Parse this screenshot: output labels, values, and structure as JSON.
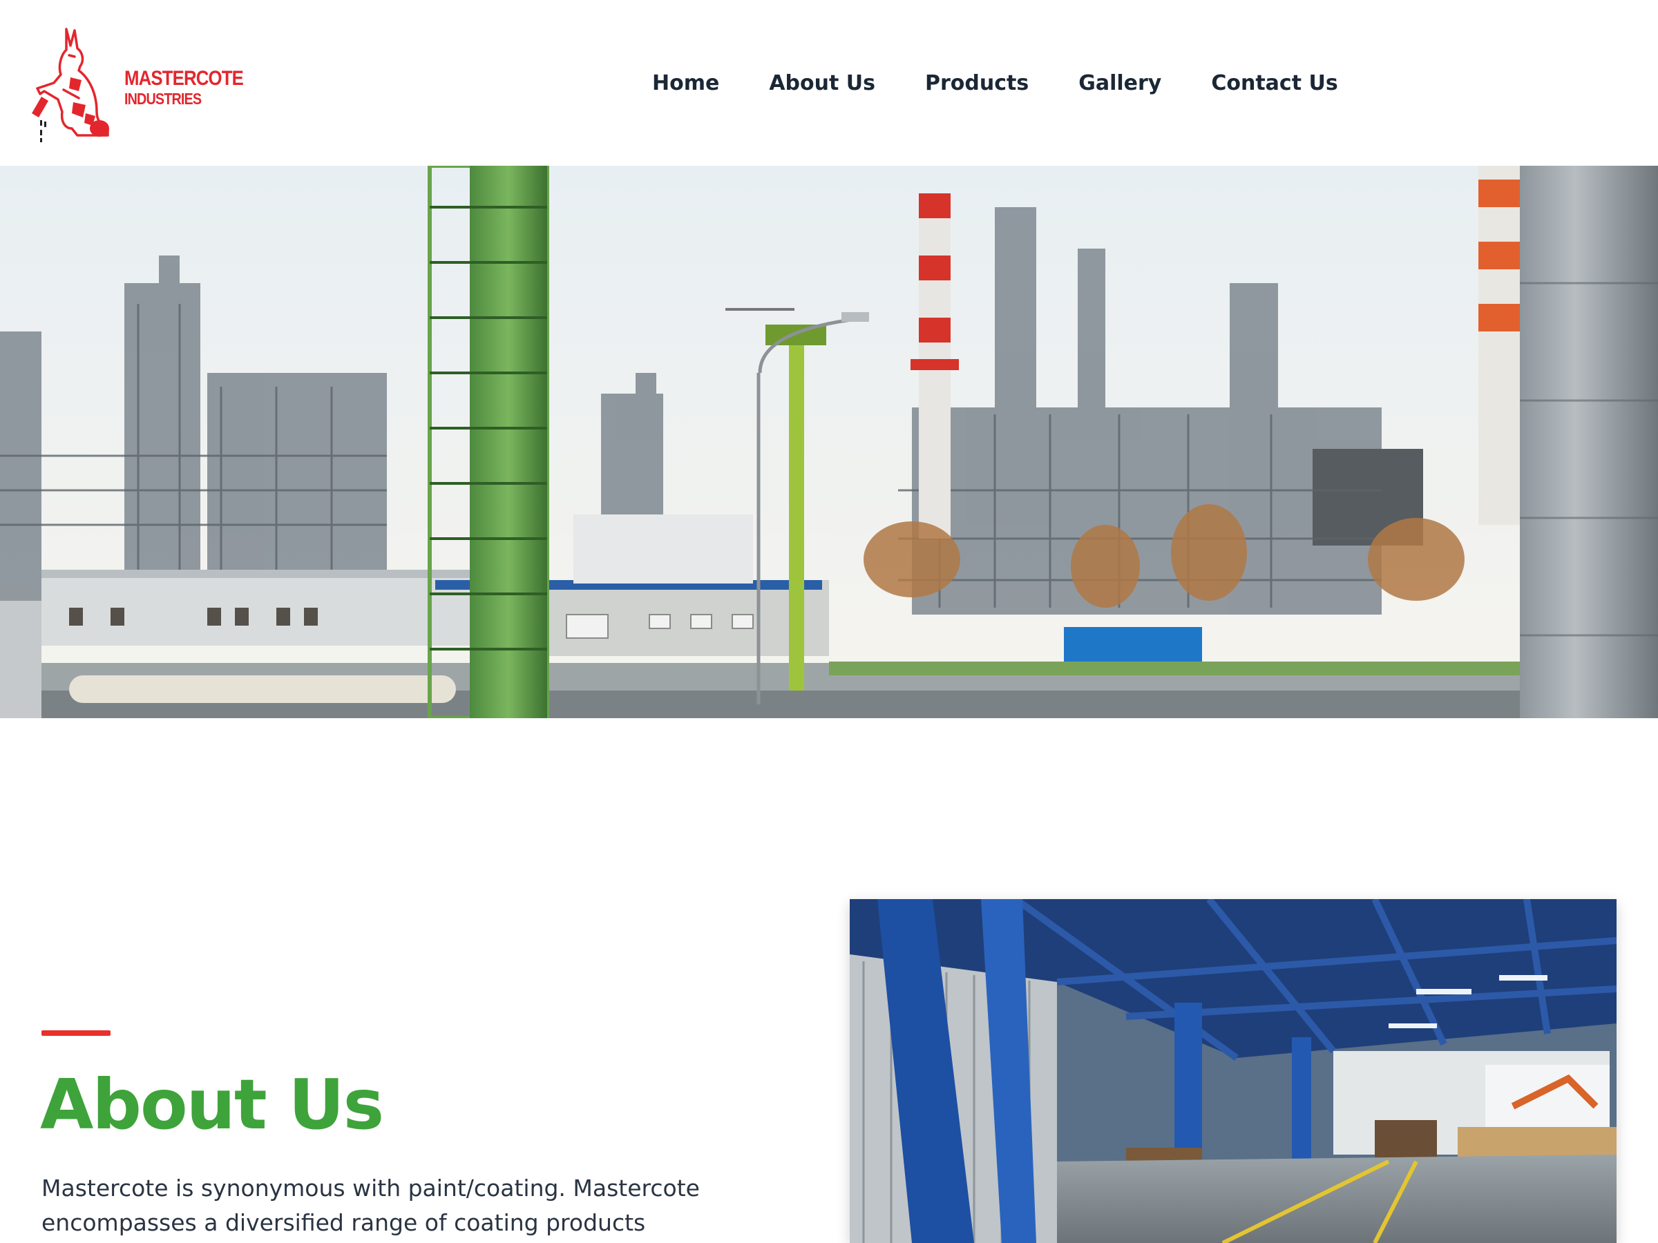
{
  "brand": {
    "name": "MASTERCOTE",
    "subtitle": "INDUSTRIES",
    "color": "#e3262d"
  },
  "nav": {
    "items": [
      {
        "label": "Home"
      },
      {
        "label": "About Us"
      },
      {
        "label": "Products"
      },
      {
        "label": "Gallery"
      },
      {
        "label": "Contact Us"
      }
    ]
  },
  "hero": {
    "image": "industrial-refinery-photo"
  },
  "about": {
    "title": "About Us",
    "title_color": "#3ea33a",
    "accent_color": "#e8312a",
    "text": "Mastercote is synonymous with paint/coating. Mastercote encompasses a diversified range of coating products manufacturing",
    "image": "factory-interior-photo"
  }
}
